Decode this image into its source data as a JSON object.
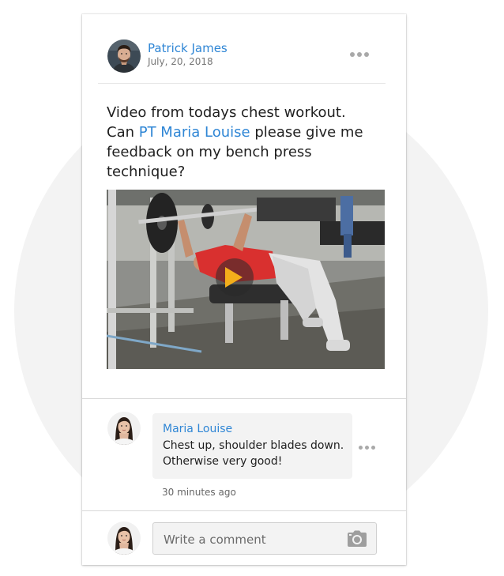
{
  "post": {
    "author_name": "Patrick James",
    "date": "July, 20, 2018",
    "text_before_mention": "Video from todays chest workout. Can ",
    "mention": "PT Maria Louise",
    "text_after_mention": " please give me feedback on my bench press technique?",
    "more_icon": "more-horizontal-icon",
    "video_icon": "play-icon",
    "accent_color": "#2f86d5",
    "play_color": "#f3ae1b"
  },
  "comment": {
    "author_name": "Maria Louise",
    "text": "Chest up, shoulder blades down. Otherwise very good!",
    "time": "30 minutes ago",
    "more_icon": "more-horizontal-icon"
  },
  "composer": {
    "placeholder": "Write a comment",
    "attach_icon": "camera-icon"
  }
}
